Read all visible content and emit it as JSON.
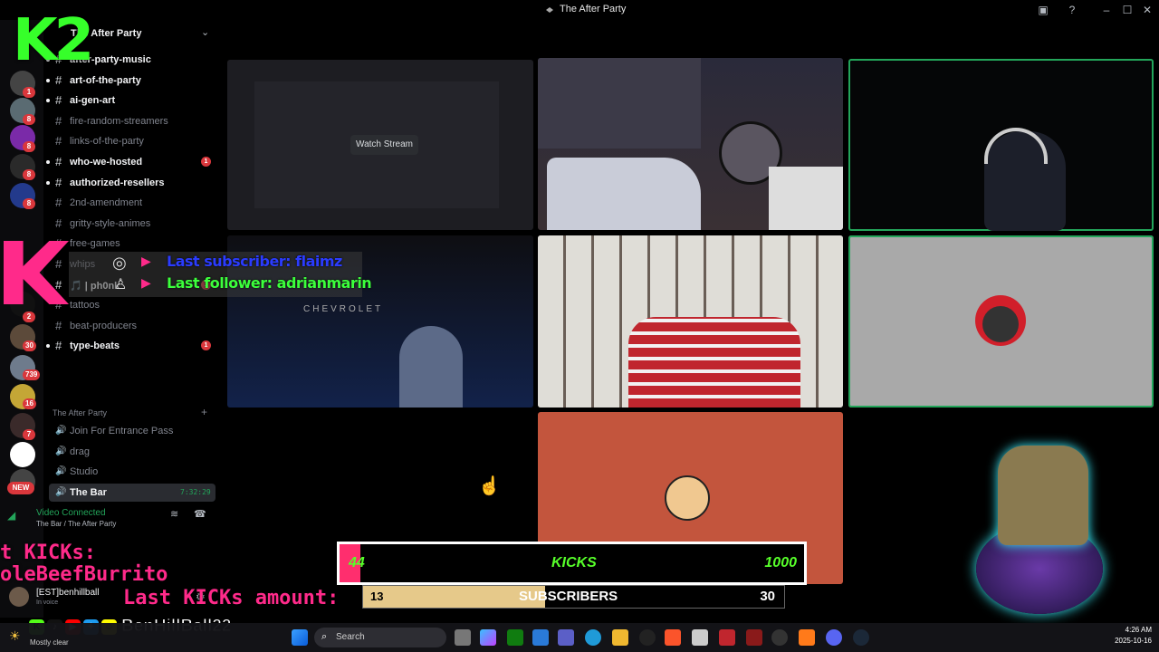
{
  "window": {
    "title": "The After Party"
  },
  "overlay_logo": "K2",
  "server": {
    "name": "The After Party"
  },
  "channels": [
    {
      "label": "after-party-music",
      "unread": true,
      "badge": ""
    },
    {
      "label": "art-of-the-party",
      "unread": true,
      "badge": ""
    },
    {
      "label": "ai-gen-art",
      "unread": true,
      "badge": ""
    },
    {
      "label": "fire-random-streamers",
      "unread": false,
      "badge": ""
    },
    {
      "label": "links-of-the-party",
      "unread": false,
      "badge": ""
    },
    {
      "label": "who-we-hosted",
      "unread": true,
      "badge": "1"
    },
    {
      "label": "authorized-resellers",
      "unread": true,
      "badge": ""
    },
    {
      "label": "2nd-amendment",
      "unread": false,
      "badge": ""
    },
    {
      "label": "gritty-style-animes",
      "unread": false,
      "badge": ""
    },
    {
      "label": "free-games",
      "unread": false,
      "badge": ""
    },
    {
      "label": "whips",
      "unread": false,
      "badge": ""
    },
    {
      "label": "🎵 | ph0nk",
      "unread": true,
      "badge": "1"
    },
    {
      "label": "tattoos",
      "unread": false,
      "badge": ""
    },
    {
      "label": "beat-producers",
      "unread": false,
      "badge": ""
    },
    {
      "label": "type-beats",
      "unread": true,
      "badge": "1"
    }
  ],
  "voice_category": "The After Party",
  "voice_channels": [
    {
      "label": "Join For Entrance Pass",
      "active": false
    },
    {
      "label": "drag",
      "active": false
    },
    {
      "label": "Studio",
      "active": false
    },
    {
      "label": "The Bar",
      "active": true,
      "timer": "7:32:29"
    }
  ],
  "voice_status": {
    "state": "Video Connected",
    "location": "The Bar / The After Party"
  },
  "user": {
    "name": "[EST]benhillball",
    "status": "In voice"
  },
  "rail_badges": [
    "1",
    "8",
    "8",
    "8",
    "8",
    "2",
    "30",
    "739",
    "16",
    "7",
    "6"
  ],
  "rail_new": "NEW",
  "stream": {
    "watch_label": "Watch Stream"
  },
  "tile_texts": {
    "chevrolet": "CHEVROLET"
  },
  "overlay": {
    "last_subscriber": "Last subscriber: flaimz",
    "last_follower": "Last follower: adrianmarin",
    "ticker_line1": "t KICKs:",
    "ticker_line2": "oleBeefBurrito",
    "ticker_line3": "Last KICKs amount:",
    "handle": "BenHillBall22"
  },
  "kicks_goal": {
    "current": "44",
    "label": "KICKS",
    "target": "1000",
    "fraction": 0.044
  },
  "subs_goal": {
    "current": "13",
    "label": "SUBSCRIBERS",
    "target": "30",
    "fraction": 0.433
  },
  "taskbar": {
    "weather": "Mostly clear",
    "search_placeholder": "Search",
    "time": "4:26 AM",
    "date": "2025-10-16"
  },
  "colors": {
    "accent_green": "#23a55a",
    "badge_red": "#da373c",
    "goal_pink": "#ff2e6e",
    "goal_text_green": "#57ff2a",
    "sub_fill": "#e6c98a"
  }
}
